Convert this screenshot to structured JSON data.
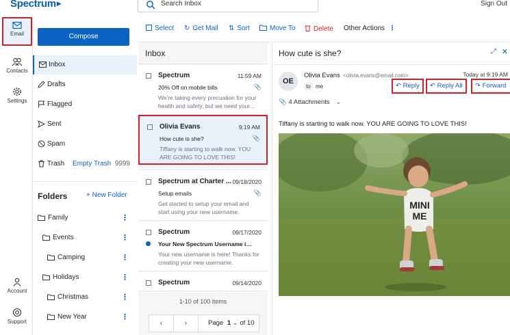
{
  "header": {
    "logo": "Spectrum",
    "search_placeholder": "Search Inbox",
    "sign_out": "Sign Out"
  },
  "rail": {
    "email": "Email",
    "contacts": "Contacts",
    "settings": "Settings",
    "account": "Account",
    "support": "Support"
  },
  "sidebar": {
    "compose": "Compose",
    "mailboxes": [
      {
        "label": "Inbox"
      },
      {
        "label": "Drafts"
      },
      {
        "label": "Flagged"
      },
      {
        "label": "Sent"
      },
      {
        "label": "Spam"
      },
      {
        "label": "Trash"
      }
    ],
    "empty_trash": "Empty Trash",
    "trash_count": "9999",
    "folders_title": "Folders",
    "new_folder": "+ New Folder",
    "folders": [
      {
        "label": "Family"
      },
      {
        "label": "Events"
      },
      {
        "label": "Camping"
      },
      {
        "label": "Holidays"
      },
      {
        "label": "Christmas"
      },
      {
        "label": "New Year"
      }
    ],
    "kebab": "⋮"
  },
  "toolbar": {
    "select": "Select",
    "get_mail": "Get Mail",
    "sort": "Sort",
    "move_to": "Move To",
    "delete": "Delete",
    "other_actions": "Other Actions"
  },
  "inbox": {
    "title": "Inbox",
    "messages": [
      {
        "from": "Spectrum",
        "time": "11:59 AM",
        "subject": "20% Off on mobile bills",
        "preview": "We're taking every precuation for your health and safety, but we need your...",
        "attachment": true,
        "unread": false
      },
      {
        "from": "Olivia Evans",
        "time": "9:19 AM",
        "subject": "How cute is she?",
        "preview": "Tiffany is starting to walk now. YOU ARE GOING TO LOVE THIS!",
        "attachment": true,
        "unread": false
      },
      {
        "from": "Spectrum at Charter ...",
        "time": "09/18/2020",
        "subject": "Setup emails",
        "preview": "Get started to setup your email and start using your new username.",
        "attachment": true,
        "unread": false
      },
      {
        "from": "Spectrum",
        "time": "09/17/2020",
        "subject": "Your New Spectrum Username is he ...",
        "preview": "Your new username is here! Thanks for creating your new username.",
        "attachment": false,
        "unread": true
      },
      {
        "from": "Spectrum",
        "time": "09/14/2020",
        "subject": "",
        "preview": "",
        "attachment": false,
        "unread": false
      }
    ],
    "pager_info": "1-10 of 100 items",
    "page_label": "Page",
    "page_current": "1",
    "page_of": "of 10"
  },
  "reader": {
    "subject": "How cute is she?",
    "avatar": "OE",
    "sender_name": "Olivia Evans",
    "sender_email": "<olivia.evans@email.com>",
    "to_label": "to",
    "to_name": "me",
    "time": "Today at 9:19 AM",
    "reply": "Reply",
    "reply_all": "Reply All",
    "forward": "Forward",
    "attachments": "4 Attachments",
    "body": "Tiffany is starting to walk now. YOU ARE GOING TO LOVE THIS!",
    "shirt_text_1": "MINI",
    "shirt_text_2": "ME"
  },
  "colors": {
    "accent": "#0c63c2",
    "highlight": "#d51f26",
    "selected_bg": "#e9f1fb"
  }
}
